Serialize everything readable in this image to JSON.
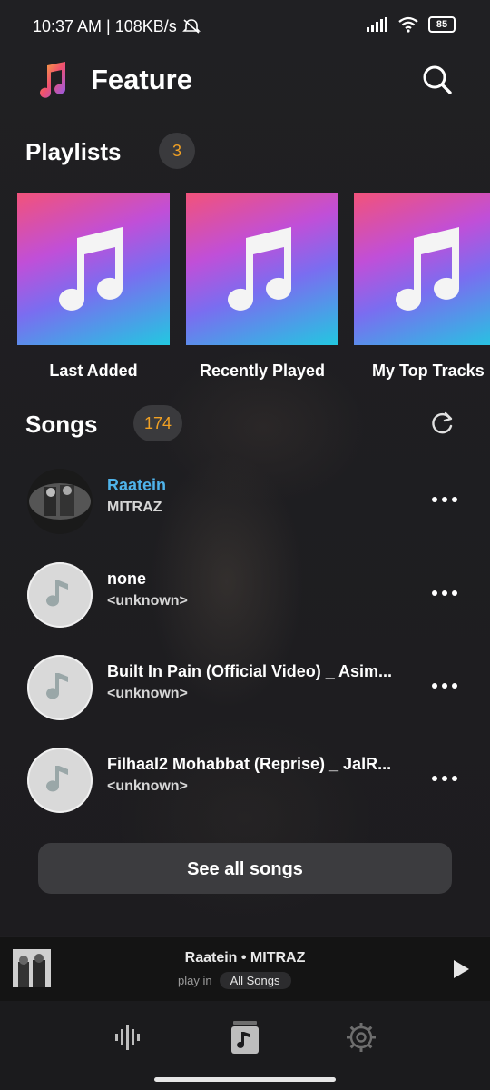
{
  "status": {
    "time_speed": "10:37 AM | 108KB/s",
    "battery": "85"
  },
  "header": {
    "title": "Feature"
  },
  "playlists": {
    "title": "Playlists",
    "count": "3",
    "items": [
      {
        "label": "Last Added"
      },
      {
        "label": "Recently Played"
      },
      {
        "label": "My Top Tracks"
      }
    ]
  },
  "songs": {
    "title": "Songs",
    "count": "174",
    "items": [
      {
        "title": "Raatein",
        "artist": "MITRAZ",
        "active": true
      },
      {
        "title": "none",
        "artist": "<unknown>",
        "active": false
      },
      {
        "title": "Built In Pain (Official Video) _ Asim...",
        "artist": "<unknown>",
        "active": false
      },
      {
        "title": "Filhaal2 Mohabbat (Reprise) _ JalR...",
        "artist": "<unknown>",
        "active": false
      }
    ],
    "see_all": "See all songs"
  },
  "mini_player": {
    "now_playing": "Raatein • MITRAZ",
    "play_in": "play in",
    "source": "All Songs"
  },
  "colors": {
    "accent_active": "#4fb3ea",
    "badge_text": "#f0a024"
  }
}
